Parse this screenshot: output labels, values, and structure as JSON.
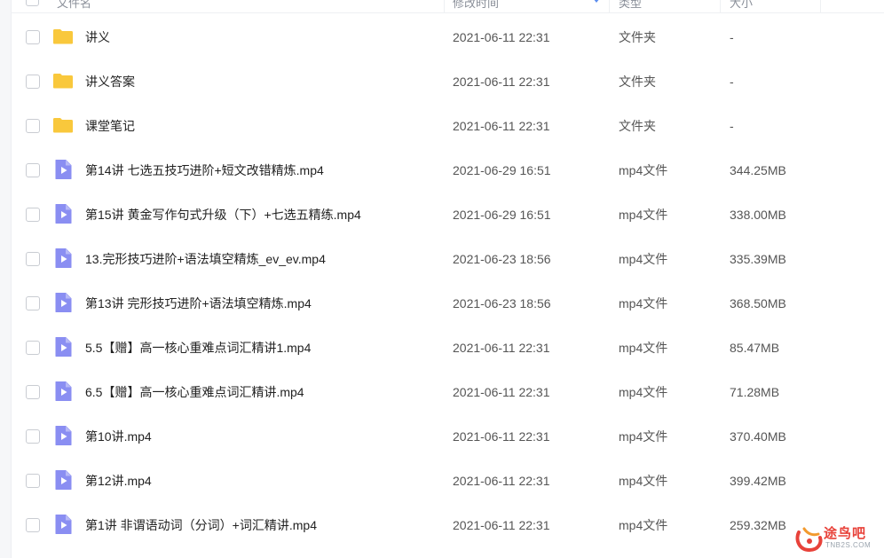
{
  "header": {
    "col_name": "文件名",
    "col_time": "修改时间",
    "col_type": "类型",
    "col_size": "大小"
  },
  "files": [
    {
      "name": "讲义",
      "time": "2021-06-11 22:31",
      "type": "文件夹",
      "size": "-",
      "icon": "folder-icon"
    },
    {
      "name": "讲义答案",
      "time": "2021-06-11 22:31",
      "type": "文件夹",
      "size": "-",
      "icon": "folder-icon"
    },
    {
      "name": "课堂笔记",
      "time": "2021-06-11 22:31",
      "type": "文件夹",
      "size": "-",
      "icon": "folder-icon"
    },
    {
      "name": "第14讲 七选五技巧进阶+短文改错精炼.mp4",
      "time": "2021-06-29 16:51",
      "type": "mp4文件",
      "size": "344.25MB",
      "icon": "video-file-icon"
    },
    {
      "name": "第15讲 黄金写作句式升级（下）+七选五精练.mp4",
      "time": "2021-06-29 16:51",
      "type": "mp4文件",
      "size": "338.00MB",
      "icon": "video-file-icon"
    },
    {
      "name": "13.完形技巧进阶+语法填空精炼_ev_ev.mp4",
      "time": "2021-06-23 18:56",
      "type": "mp4文件",
      "size": "335.39MB",
      "icon": "video-file-icon"
    },
    {
      "name": "第13讲 完形技巧进阶+语法填空精炼.mp4",
      "time": "2021-06-23 18:56",
      "type": "mp4文件",
      "size": "368.50MB",
      "icon": "video-file-icon"
    },
    {
      "name": "5.5【赠】高一核心重难点词汇精讲1.mp4",
      "time": "2021-06-11 22:31",
      "type": "mp4文件",
      "size": "85.47MB",
      "icon": "video-file-icon"
    },
    {
      "name": "6.5【赠】高一核心重难点词汇精讲.mp4",
      "time": "2021-06-11 22:31",
      "type": "mp4文件",
      "size": "71.28MB",
      "icon": "video-file-icon"
    },
    {
      "name": "第10讲.mp4",
      "time": "2021-06-11 22:31",
      "type": "mp4文件",
      "size": "370.40MB",
      "icon": "video-file-icon"
    },
    {
      "name": "第12讲.mp4",
      "time": "2021-06-11 22:31",
      "type": "mp4文件",
      "size": "399.42MB",
      "icon": "video-file-icon"
    },
    {
      "name": "第1讲 非谓语动词（分词）+词汇精讲.mp4",
      "time": "2021-06-11 22:31",
      "type": "mp4文件",
      "size": "259.32MB",
      "icon": "video-file-icon"
    }
  ],
  "watermark": {
    "text": "途鸟吧",
    "sub": "TNB2S.COM"
  },
  "colors": {
    "folder": "#f9c83c",
    "video": "#8a8ef2",
    "sort_arrow": "#5b8def",
    "watermark": "#e8423a"
  }
}
